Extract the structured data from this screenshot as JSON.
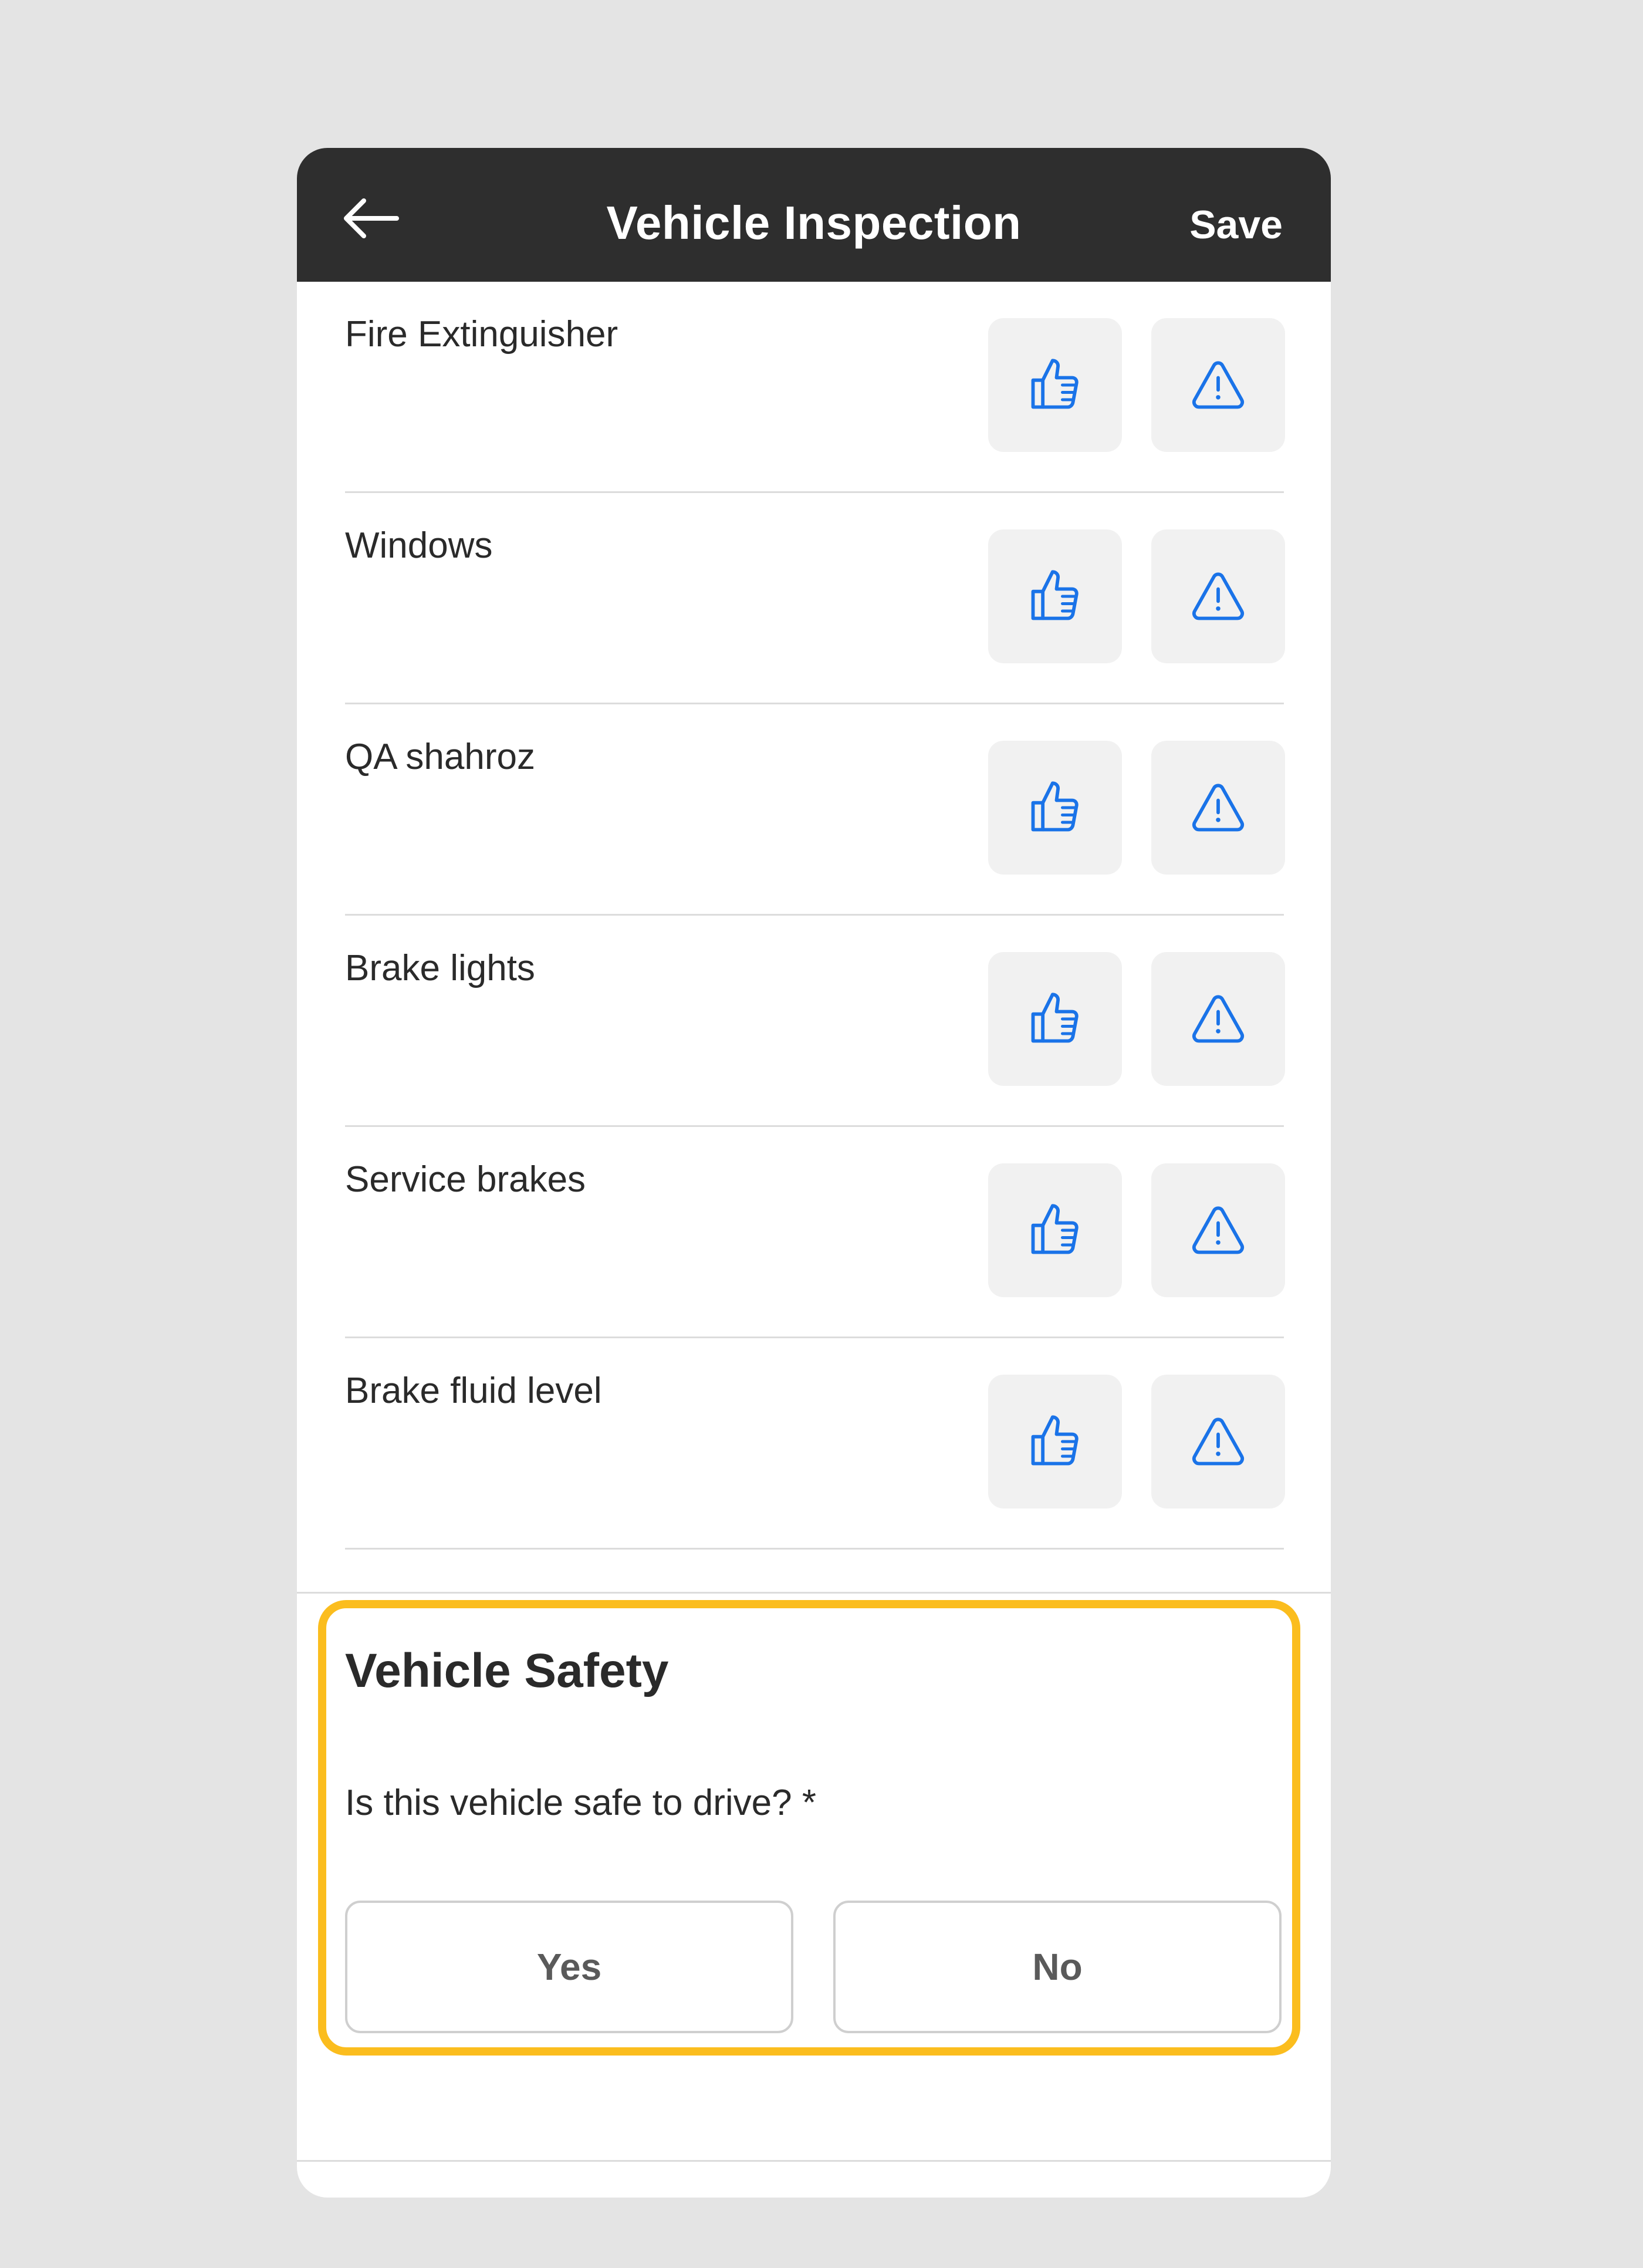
{
  "header": {
    "title": "Vehicle Inspection",
    "save_label": "Save",
    "back_icon": "arrow-left-icon"
  },
  "inspection_items": [
    {
      "label": "Fire Extinguisher",
      "pass_icon": "thumbs-up-icon",
      "flag_icon": "warning-triangle-icon"
    },
    {
      "label": "Windows",
      "pass_icon": "thumbs-up-icon",
      "flag_icon": "warning-triangle-icon"
    },
    {
      "label": "QA shahroz",
      "pass_icon": "thumbs-up-icon",
      "flag_icon": "warning-triangle-icon"
    },
    {
      "label": "Brake lights",
      "pass_icon": "thumbs-up-icon",
      "flag_icon": "warning-triangle-icon"
    },
    {
      "label": "Service brakes",
      "pass_icon": "thumbs-up-icon",
      "flag_icon": "warning-triangle-icon"
    },
    {
      "label": "Brake fluid level",
      "pass_icon": "thumbs-up-icon",
      "flag_icon": "warning-triangle-icon"
    }
  ],
  "safety": {
    "title": "Vehicle Safety",
    "question": "Is this vehicle safe to drive? *",
    "yes_label": "Yes",
    "no_label": "No"
  },
  "colors": {
    "header_bg": "#2e2e2e",
    "icon_blue": "#1a73e8",
    "highlight_border": "#fbbd1e",
    "button_bg": "#f1f1f1",
    "page_bg": "#e4e4e4"
  }
}
